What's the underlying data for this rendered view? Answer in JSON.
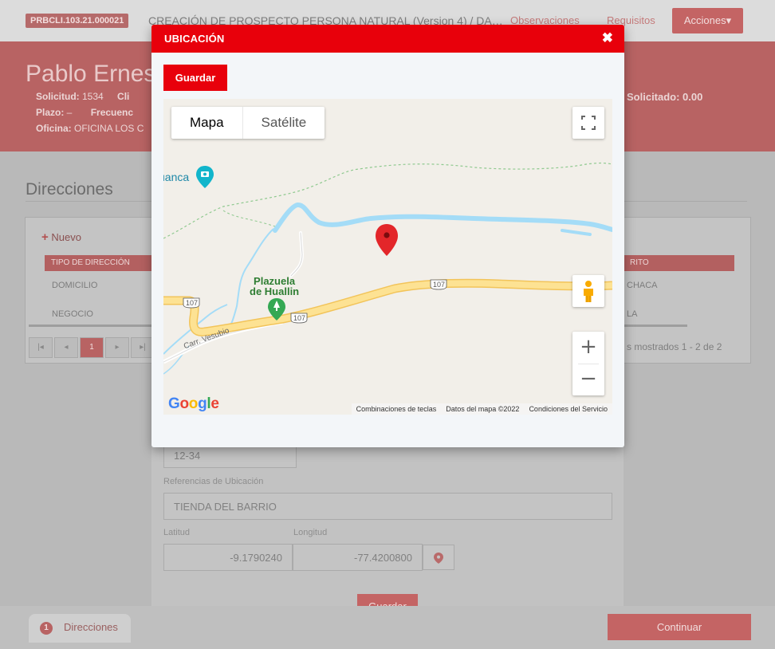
{
  "topbar": {
    "code": "PRBCLI.103.21.000021",
    "title": "CREACIÓN DE PROSPECTO PERSONA NATURAL   (Version 4) / DA…",
    "observaciones": "Observaciones",
    "requisitos": "Requisitos",
    "acciones": "Acciones▾"
  },
  "client": {
    "name": "Pablo Ernest",
    "solicitud_label": "Solicitud:",
    "solicitud_value": " 1534",
    "cli_label": "Cli",
    "plazo_label": "Plazo:",
    "plazo_value": " –",
    "frecuencia_label": "Frecuenc",
    "oficina_label": "Oficina:",
    "oficina_value": " OFICINA LOS C",
    "solicitado": "Solicitado: 0.00"
  },
  "direcciones": {
    "title": "Direcciones",
    "nuevo": "Nuevo",
    "col_tipo": "TIPO DE DIRECCIÓN",
    "col_dist": "RITO",
    "rows": [
      {
        "tipo": "DOMICILIO",
        "dist": "CHACA"
      },
      {
        "tipo": "NEGOCIO",
        "dist": "LA"
      }
    ],
    "page": "1",
    "showing": "s mostrados 1 - 2 de 2"
  },
  "form": {
    "numero_value": "12-34",
    "referencias_label": "Referencias de Ubicación",
    "referencias_value": "TIENDA DEL BARRIO",
    "latitud_label": "Latitud",
    "latitud_value": "-9.1790240",
    "longitud_label": "Longitud",
    "longitud_value": "-77.4200800",
    "save_label": "Guardar"
  },
  "bottom": {
    "step_number": "1",
    "step_label": "Direcciones",
    "continuar": "Continuar"
  },
  "modal": {
    "title": "UBICACIÓN",
    "close": "✖",
    "save_label": "Guardar",
    "map": {
      "type_map": "Mapa",
      "type_satellite": "Satélite",
      "zoom_in": "+",
      "zoom_out": "−",
      "place_top": "uanca",
      "place_main_line1": "Plazuela",
      "place_main_line2": "de Huallin",
      "road_107_a": "107",
      "road_107_b": "107",
      "road_107_c": "107",
      "road_vesubio": "Carr. Vesubio",
      "footer_keys": "Combinaciones de teclas",
      "footer_data": "Datos del mapa ©2022",
      "footer_terms": "Condiciones del Servicio",
      "google": "Google",
      "colors": {
        "water": "#a4dcf7",
        "road": "#fde293",
        "park": "#34a853",
        "marker": "#e3262a"
      }
    }
  }
}
